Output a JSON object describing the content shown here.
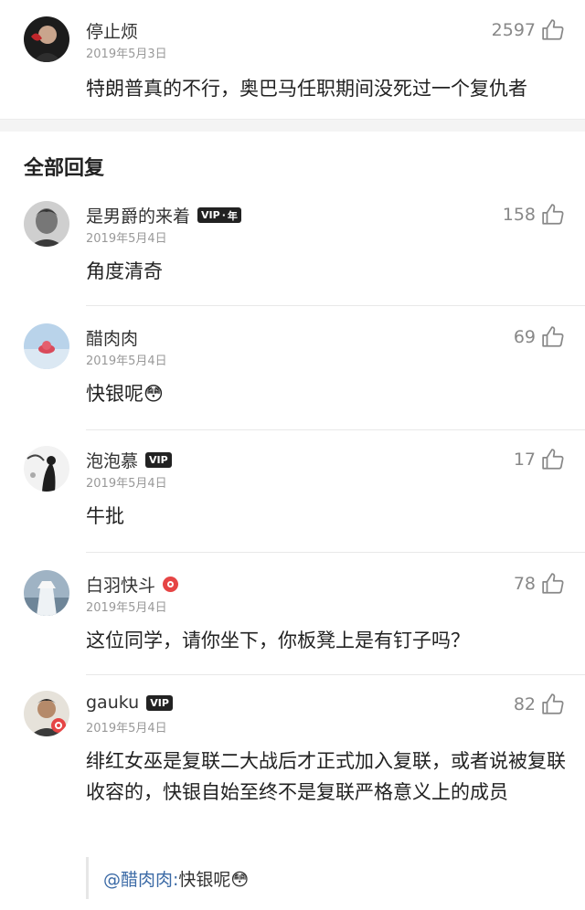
{
  "top_comment": {
    "user": "停止烦",
    "date": "2019年5月3日",
    "likes": "2597",
    "text": "特朗普真的不行，奥巴马任职期间没死过一个复仇者"
  },
  "section_title": "全部回复",
  "replies": [
    {
      "user": "是男爵的来着",
      "badge": "vip-year",
      "badge_text": "VIP",
      "badge_suffix": "年",
      "date": "2019年5月4日",
      "likes": "158",
      "text": "角度清奇"
    },
    {
      "user": "醋肉肉",
      "badge": "",
      "date": "2019年5月4日",
      "likes": "69",
      "text": "快银呢😳"
    },
    {
      "user": "泡泡慕",
      "badge": "vip",
      "badge_text": "VIP",
      "date": "2019年5月4日",
      "likes": "17",
      "text": "牛批"
    },
    {
      "user": "白羽快斗",
      "badge": "red",
      "date": "2019年5月4日",
      "likes": "78",
      "text": "这位同学，请你坐下，你板凳上是有钉子吗？"
    },
    {
      "user": "gauku",
      "badge": "vip",
      "badge_text": "VIP",
      "date": "2019年5月4日",
      "likes": "82",
      "text": "绯红女巫是复联二大战后才正式加入复联，或者说被复联收容的，快银自始至终不是复联严格意义上的成员"
    }
  ],
  "quote": {
    "mention": "@醋肉肉:",
    "text": " 快银呢😳"
  },
  "icons": {
    "like": "thumbs-up-icon"
  },
  "colors": {
    "mention": "#3b6aa6",
    "badge_red": "#e64545"
  }
}
